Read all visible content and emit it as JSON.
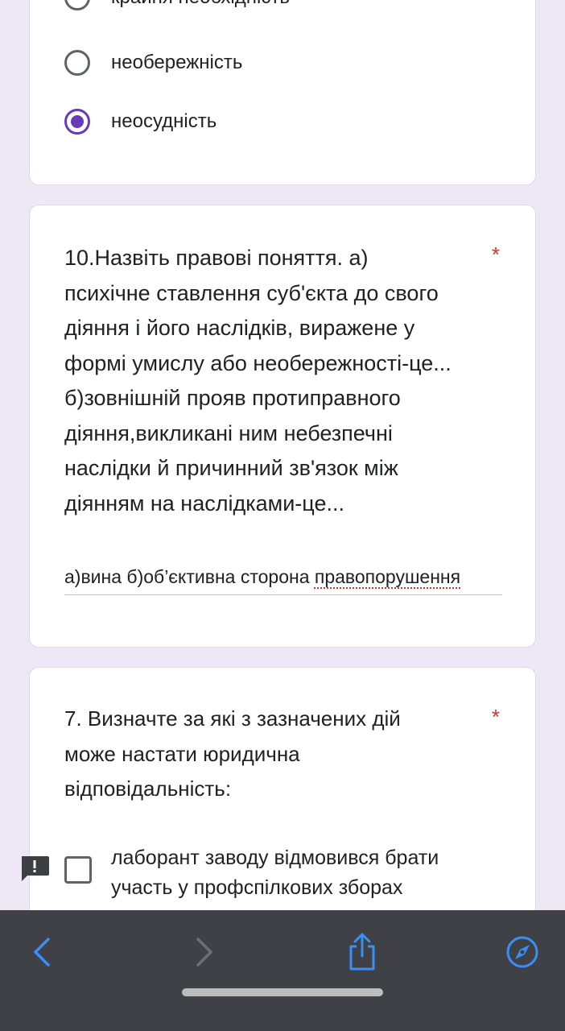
{
  "question9": {
    "options": [
      {
        "label": "крайня необхідність",
        "selected": false
      },
      {
        "label": "необережність",
        "selected": false
      },
      {
        "label": "неосудність",
        "selected": true
      }
    ],
    "accent_color": "#673ab7"
  },
  "question10": {
    "lines": [
      "10.Назвіть правові поняття.  а)",
      "психічне ставлення суб'єкта до свого",
      "діяння і його наслідків, виражене у",
      "формі умислу або необережності-це...",
      "б)зовнішній прояв протиправного",
      "діяння,викликані ним  небезпечні",
      "наслідки й причинний зв'язок між",
      "діянням на наслідками-це..."
    ],
    "required_mark": "*",
    "answer_plain": "а)вина б)об’єктивна сторона ",
    "answer_misspelled": "правопорушення"
  },
  "question7": {
    "title_lines": [
      "7. Визначте за які з зазначених дій",
      "може настати юридична",
      "відповідальність:"
    ],
    "required_mark": "*",
    "option_label": "лаборант заводу відмовився брати участь у профспілкових зборах",
    "option_checked": false
  },
  "browser_toolbar": {
    "icons": [
      "back-arrow-icon",
      "forward-arrow-icon",
      "share-icon",
      "compass-icon"
    ],
    "icon_color": "#3a8ef6"
  },
  "feedback_icon": "report-icon"
}
